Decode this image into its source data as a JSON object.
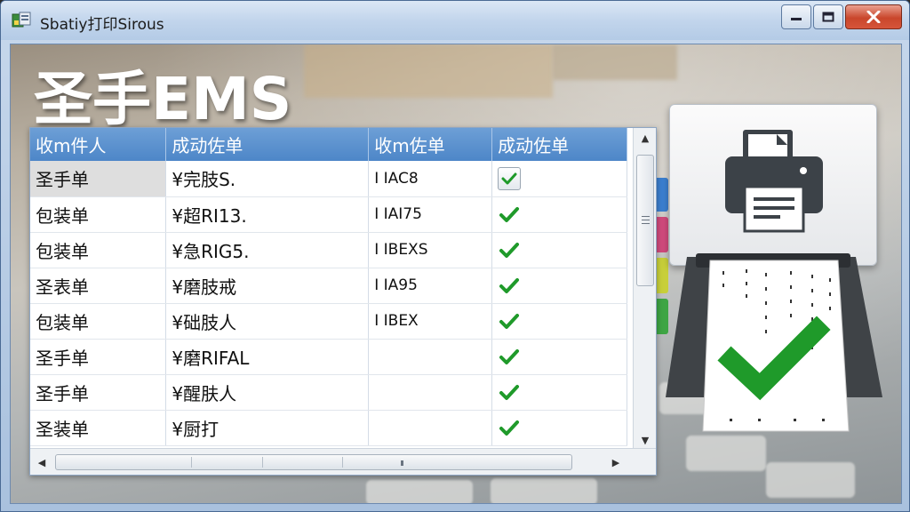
{
  "window": {
    "title": "Sbatiy打印Sirous",
    "buttons": {
      "minimize": "minimize-icon",
      "maximize": "maximize-icon",
      "close": "close-icon"
    }
  },
  "brand": {
    "title": "圣手EMS"
  },
  "grid": {
    "columns": [
      "收m件人",
      "成动佐单",
      "收m佐单",
      "成动佐单"
    ],
    "rows": [
      {
        "type": "圣手单",
        "name": "¥完肢S.",
        "code": "I IAC8",
        "status": "checked-box"
      },
      {
        "type": "包装单",
        "name": "¥超RI13.",
        "code": "I IAI75",
        "status": "check"
      },
      {
        "type": "包装单",
        "name": "¥急RIG5.",
        "code": "I IBEXS",
        "status": "check"
      },
      {
        "type": "圣表单",
        "name": "¥磨肢戒",
        "code": "I IA95",
        "status": "check"
      },
      {
        "type": "包装单",
        "name": "¥础肢人",
        "code": "I IBEX",
        "status": "check"
      },
      {
        "type": "圣手单",
        "name": "¥磨RIFAL",
        "code": "",
        "status": "check"
      },
      {
        "type": "圣手单",
        "name": "¥醒肤人",
        "code": "",
        "status": "check"
      },
      {
        "type": "圣装单",
        "name": "¥厨打",
        "code": "",
        "status": "check"
      }
    ],
    "selected_row": 0
  },
  "icons": {
    "printer": "printer-icon",
    "success": "checkmark-icon",
    "accent_green": "#1f9a2a",
    "header_blue": "#5a91cf"
  }
}
